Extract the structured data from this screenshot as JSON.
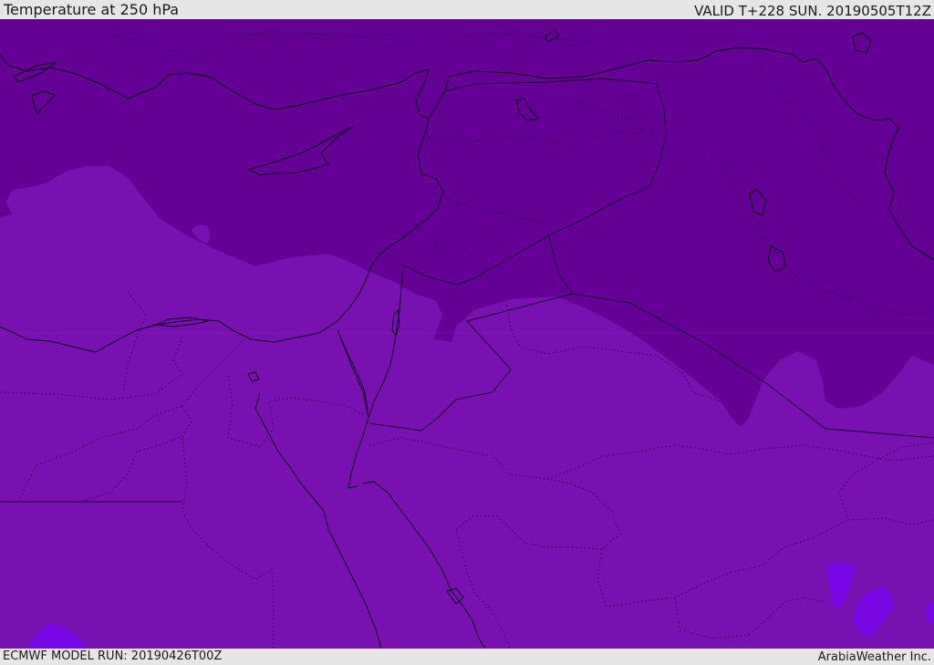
{
  "header": {
    "title": "Temperature at 250 hPa",
    "valid": "VALID T+228 SUN. 20190505T12Z"
  },
  "footer": {
    "model_run": "ECMWF MODEL RUN: 20190426T00Z",
    "credit": "ArabiaWeather Inc."
  },
  "map": {
    "field": "temperature",
    "level": "250 hPa",
    "colors": {
      "cold_region": "#650095",
      "base_region": "#7911b0",
      "warm_patch": "#7a06e6",
      "coastline": "#0b0014",
      "border": "#1b0030"
    }
  }
}
